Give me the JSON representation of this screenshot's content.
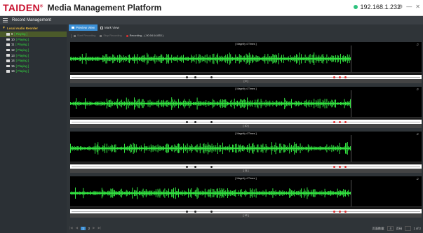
{
  "header": {
    "brand": "TAIDEN",
    "trademark": "®",
    "title": "Media Management Platform",
    "ip": "192.168.1.232",
    "ip_status_color": "#2ec27e",
    "window_buttons": [
      "⚙",
      "—",
      "✕"
    ]
  },
  "menubar": {
    "title": "Record Management"
  },
  "sidebar": {
    "root_label": "Local Audio Reorder",
    "items": [
      {
        "label": "9",
        "status": "[ Playing ]"
      },
      {
        "label": "10",
        "status": "[ Playing ]"
      },
      {
        "label": "11",
        "status": "[ Playing ]"
      },
      {
        "label": "12",
        "status": "[ Playing ]"
      },
      {
        "label": "13",
        "status": "[ Playing ]"
      },
      {
        "label": "14",
        "status": "[ Playing ]"
      },
      {
        "label": "15",
        "status": "[ Playing ]"
      },
      {
        "label": "16",
        "status": "[ Playing ]"
      }
    ]
  },
  "tabs": [
    {
      "label": "Preview View"
    },
    {
      "label": "Mark View"
    }
  ],
  "toolbar": {
    "start_recording": "Start Recording",
    "stop_recording": "Stop Recording",
    "recording_status": "Recording... ( 00:04:14.833 )"
  },
  "panels": [
    {
      "caption": "[ Magnify 4 Times ]",
      "footer": "[ 9 ]"
    },
    {
      "caption": "[ Magnify 4 Times ]",
      "footer": "[ 10 ]"
    },
    {
      "caption": "[ Magnify 4 Times ]",
      "footer": "[ 11 ]"
    },
    {
      "caption": "[ Magnify 4 Times ]",
      "footer": "[ 12 ]"
    }
  ],
  "colors": {
    "accent": "#3a8fd6",
    "waveform": "#33e040",
    "brand_red": "#c8102e",
    "playing": "#33e040"
  },
  "pager": {
    "first": "|◀",
    "prev": "◀",
    "pages": [
      "1",
      "2"
    ],
    "next": "▶",
    "last": "▶|",
    "per_page_label": "页面数量:",
    "per_page_value": "4",
    "jump_label": "页码",
    "page_info": "1 of 2"
  }
}
